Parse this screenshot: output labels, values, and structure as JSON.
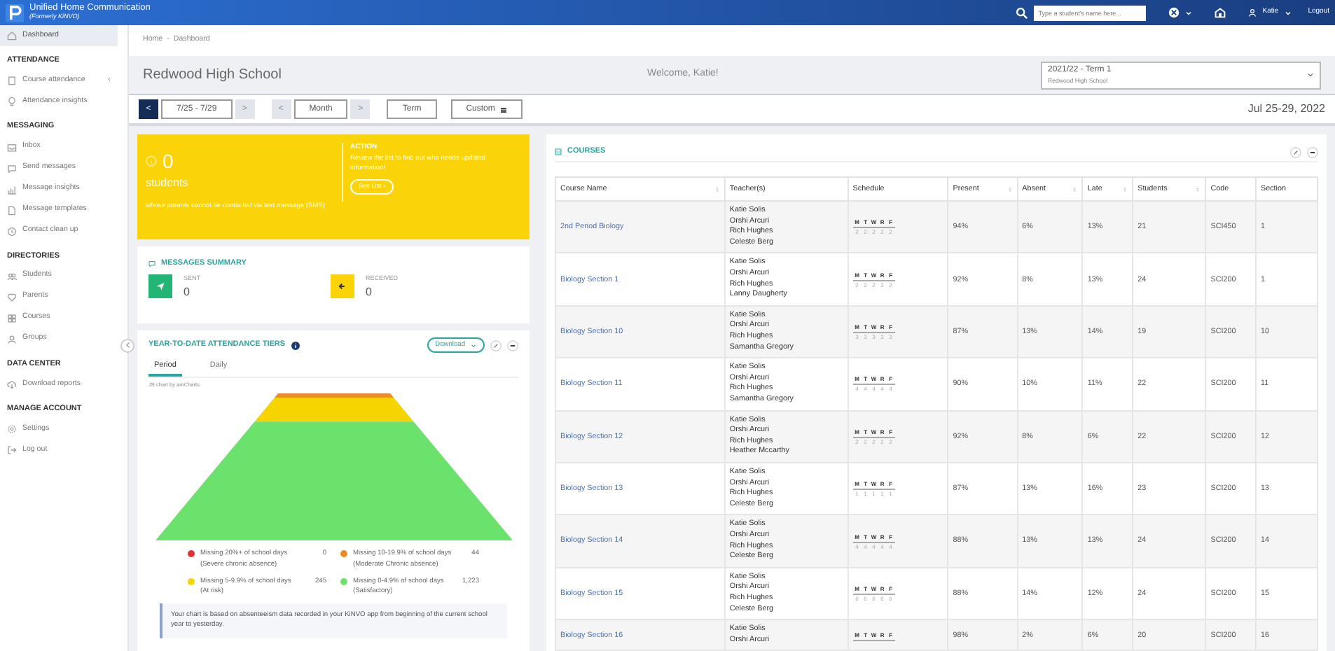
{
  "topbar": {
    "app_title": "Unified Home Communication",
    "app_subtitle": "(Formerly KiNVO)",
    "search": {
      "placeholder": "Type a student's name here..."
    },
    "user": "Katie",
    "logout": "Logout"
  },
  "sidebar": {
    "sections": [
      {
        "items": [
          {
            "label": "Dashboard",
            "selected": true
          }
        ]
      },
      {
        "heading": "ATTENDANCE",
        "items": [
          {
            "label": "Course attendance",
            "selected": false,
            "expand": "‹"
          },
          {
            "label": "Attendance insights",
            "selected": false
          }
        ]
      },
      {
        "heading": "MESSAGING",
        "items": [
          {
            "label": "Inbox",
            "selected": false
          },
          {
            "label": "Send messages",
            "selected": false
          },
          {
            "label": "Message insights",
            "selected": false
          },
          {
            "label": "Message templates",
            "selected": false
          },
          {
            "label": "Contact clean up",
            "selected": false
          }
        ]
      },
      {
        "heading": "DIRECTORIES",
        "items": [
          {
            "label": "Students",
            "selected": false
          },
          {
            "label": "Parents",
            "selected": false
          },
          {
            "label": "Courses",
            "selected": false
          },
          {
            "label": "Groups",
            "selected": false
          }
        ]
      },
      {
        "heading": "DATA CENTER",
        "items": [
          {
            "label": "Download reports",
            "selected": false
          }
        ]
      },
      {
        "heading": "MANAGE ACCOUNT",
        "items": [
          {
            "label": "Settings",
            "selected": false
          },
          {
            "label": "Log out",
            "selected": false
          }
        ]
      }
    ]
  },
  "breadcrumb": {
    "items": [
      "Home",
      "Dashboard"
    ],
    "separator": "-"
  },
  "header": {
    "school": "Redwood High School",
    "welcome": "Welcome, Katie!",
    "term_select": {
      "value": "2021/22 - Term 1",
      "detail": "Redwood High School"
    }
  },
  "toolbar": {
    "week": {
      "prev": "<",
      "label": "7/25 - 7/29",
      "next": ">",
      "prev_highlighted": true
    },
    "month": {
      "prev": "<",
      "label": "Month",
      "next": ">",
      "prev_highlighted": false
    },
    "term": "Term",
    "custom": "Custom",
    "date_range": "Jul 25-29, 2022"
  },
  "alert": {
    "count": "0",
    "unit": "students",
    "description": "whose parents cannot be contacted via text message (SMS)",
    "action_title": "ACTION",
    "action_text": "Review the list to find out who needs updated information!",
    "action_button": "See List ›"
  },
  "messages_summary": {
    "title": "MESSAGES SUMMARY",
    "sent": {
      "label": "SENT",
      "value": "0"
    },
    "received": {
      "label": "RECEIVED",
      "value": "0"
    }
  },
  "attendance_tiers": {
    "title": "YEAR-TO-DATE ATTENDANCE TIERS",
    "download": "Download",
    "tabs": [
      {
        "label": "Period",
        "selected": true
      },
      {
        "label": "Daily",
        "selected": false
      }
    ],
    "credit": "JS chart by amCharts",
    "legend": [
      {
        "label": "Missing 20%+ of school days",
        "detail": "(Severe chronic absence)",
        "value": "0",
        "color": "#e0313a"
      },
      {
        "label": "Missing 10-19.9% of school days",
        "detail": "(Moderate Chronic absence)",
        "value": "44",
        "color": "#f08a24"
      },
      {
        "label": "Missing 5-9.9% of school days",
        "detail": "(At risk)",
        "value": "245",
        "color": "#f5d400"
      },
      {
        "label": "Missing 0-4.9% of school days",
        "detail": "(Satisfactory)",
        "value": "1,223",
        "color": "#6be26b"
      }
    ],
    "note": "Your chart is based on absenteeism data recorded in your KiNVO app from beginning of the current school year to yesterday."
  },
  "courses": {
    "title": "COURSES",
    "columns": [
      {
        "label": "Course Name",
        "sortable": true
      },
      {
        "label": "Teacher(s)",
        "sortable": false
      },
      {
        "label": "Schedule",
        "sortable": false
      },
      {
        "label": "Present",
        "sortable": true
      },
      {
        "label": "Absent",
        "sortable": true
      },
      {
        "label": "Late",
        "sortable": true
      },
      {
        "label": "Students",
        "sortable": true
      },
      {
        "label": "Code",
        "sortable": false
      },
      {
        "label": "Section",
        "sortable": false
      }
    ],
    "rows": [
      {
        "name": "2nd Period Biology",
        "teachers": [
          "Katie Solis",
          "Orshi Arcuri",
          "Rich Hughes",
          "Celeste Berg"
        ],
        "schedule": {
          "days": [
            "M",
            "T",
            "W",
            "R",
            "F"
          ],
          "counts": [
            "2",
            "2",
            "2",
            "2",
            "2"
          ]
        },
        "present": "94%",
        "absent": "6%",
        "late": "13%",
        "students": "21",
        "code": "SCI450",
        "section": "1"
      },
      {
        "name": "Biology Section 1",
        "teachers": [
          "Katie Solis",
          "Orshi Arcuri",
          "Rich Hughes",
          "Lanny Daugherty"
        ],
        "schedule": {
          "days": [
            "M",
            "T",
            "W",
            "R",
            "F"
          ],
          "counts": [
            "2",
            "2",
            "2",
            "2",
            "2"
          ]
        },
        "present": "92%",
        "absent": "8%",
        "late": "13%",
        "students": "24",
        "code": "SCI200",
        "section": "1"
      },
      {
        "name": "Biology Section 10",
        "teachers": [
          "Katie Solis",
          "Orshi Arcuri",
          "Rich Hughes",
          "Samantha Gregory"
        ],
        "schedule": {
          "days": [
            "M",
            "T",
            "W",
            "R",
            "F"
          ],
          "counts": [
            "3",
            "3",
            "3",
            "3",
            "3"
          ]
        },
        "present": "87%",
        "absent": "13%",
        "late": "14%",
        "students": "19",
        "code": "SCI200",
        "section": "10"
      },
      {
        "name": "Biology Section 11",
        "teachers": [
          "Katie Solis",
          "Orshi Arcuri",
          "Rich Hughes",
          "Samantha Gregory"
        ],
        "schedule": {
          "days": [
            "M",
            "T",
            "W",
            "R",
            "F"
          ],
          "counts": [
            "4",
            "4",
            "4",
            "4",
            "4"
          ]
        },
        "present": "90%",
        "absent": "10%",
        "late": "11%",
        "students": "22",
        "code": "SCI200",
        "section": "11"
      },
      {
        "name": "Biology Section 12",
        "teachers": [
          "Katie Solis",
          "Orshi Arcuri",
          "Rich Hughes",
          "Heather Mccarthy"
        ],
        "schedule": {
          "days": [
            "M",
            "T",
            "W",
            "R",
            "F"
          ],
          "counts": [
            "2",
            "2",
            "2",
            "2",
            "2"
          ]
        },
        "present": "92%",
        "absent": "8%",
        "late": "6%",
        "students": "22",
        "code": "SCI200",
        "section": "12"
      },
      {
        "name": "Biology Section 13",
        "teachers": [
          "Katie Solis",
          "Orshi Arcuri",
          "Rich Hughes",
          "Celeste Berg"
        ],
        "schedule": {
          "days": [
            "M",
            "T",
            "W",
            "R",
            "F"
          ],
          "counts": [
            "1",
            "1",
            "1",
            "1",
            "1"
          ]
        },
        "present": "87%",
        "absent": "13%",
        "late": "16%",
        "students": "23",
        "code": "SCI200",
        "section": "13"
      },
      {
        "name": "Biology Section 14",
        "teachers": [
          "Katie Solis",
          "Orshi Arcuri",
          "Rich Hughes",
          "Celeste Berg"
        ],
        "schedule": {
          "days": [
            "M",
            "T",
            "W",
            "R",
            "F"
          ],
          "counts": [
            "4",
            "4",
            "4",
            "4",
            "4"
          ]
        },
        "present": "88%",
        "absent": "13%",
        "late": "13%",
        "students": "24",
        "code": "SCI200",
        "section": "14"
      },
      {
        "name": "Biology Section 15",
        "teachers": [
          "Katie Solis",
          "Orshi Arcuri",
          "Rich Hughes",
          "Celeste Berg"
        ],
        "schedule": {
          "days": [
            "M",
            "T",
            "W",
            "R",
            "F"
          ],
          "counts": [
            "6",
            "6",
            "6",
            "6",
            "6"
          ]
        },
        "present": "88%",
        "absent": "14%",
        "late": "12%",
        "students": "24",
        "code": "SCI200",
        "section": "15"
      },
      {
        "name": "Biology Section 16",
        "teachers": [
          "Katie Solis",
          "Orshi Arcuri"
        ],
        "schedule": {
          "days": [
            "M",
            "T",
            "W",
            "R",
            "F"
          ]
        },
        "present": "98%",
        "absent": "2%",
        "late": "6%",
        "students": "20",
        "code": "SCI200",
        "section": "16"
      }
    ]
  }
}
